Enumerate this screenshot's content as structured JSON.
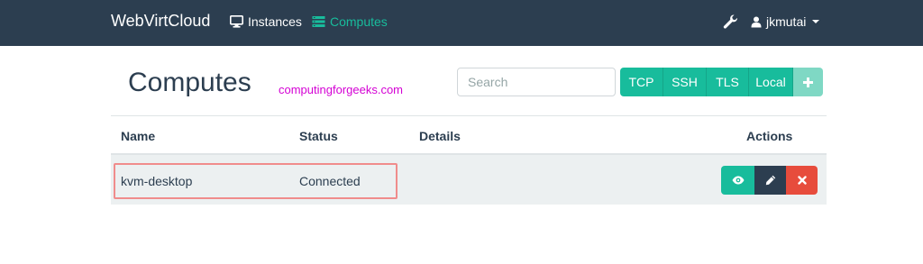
{
  "navbar": {
    "brand": "WebVirtCloud",
    "instances_label": "Instances",
    "computes_label": "Computes",
    "username": "jkmutai",
    "colors": {
      "background": "#2c3e50",
      "active": "#18bc9c"
    }
  },
  "header": {
    "title": "Computes",
    "watermark": "computingforgeeks.com",
    "search_placeholder": "Search",
    "add_buttons": [
      "TCP",
      "SSH",
      "TLS",
      "Local"
    ],
    "add_icon": "plus-icon"
  },
  "table": {
    "columns": [
      "Name",
      "Status",
      "Details",
      "Actions"
    ],
    "rows": [
      {
        "name": "kvm-desktop",
        "status": "Connected",
        "details": "",
        "actions": [
          "eye-icon",
          "pencil-icon",
          "times-icon"
        ]
      }
    ]
  }
}
